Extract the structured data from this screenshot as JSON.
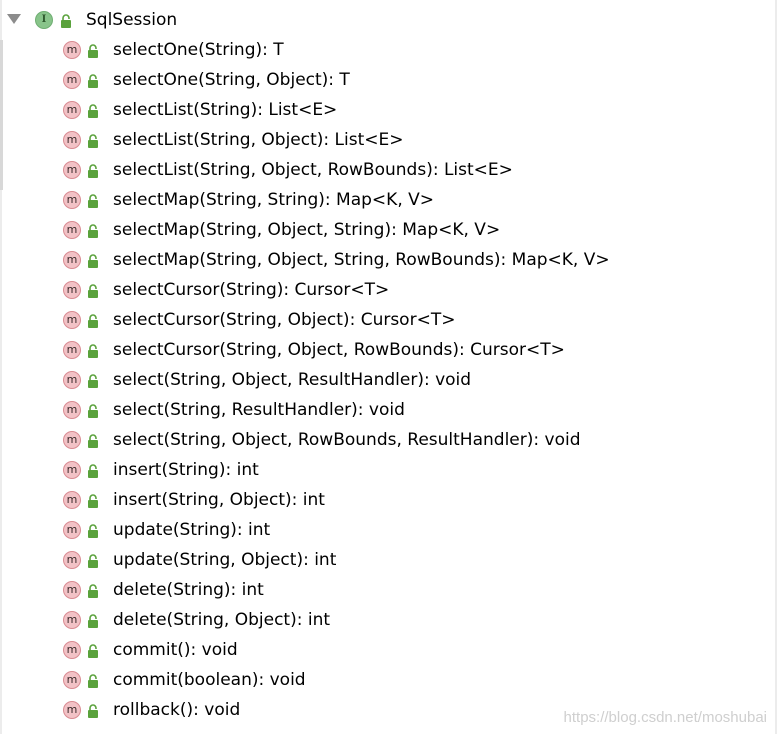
{
  "tree": {
    "root": {
      "icon": "interface-icon",
      "badge_letter": "I",
      "visibility_icon": "public-lock-icon",
      "label": "SqlSession"
    },
    "method_badge_letter": "m",
    "methods": [
      "selectOne(String): T",
      "selectOne(String, Object): T",
      "selectList(String): List<E>",
      "selectList(String, Object): List<E>",
      "selectList(String, Object, RowBounds): List<E>",
      "selectMap(String, String): Map<K, V>",
      "selectMap(String, Object, String): Map<K, V>",
      "selectMap(String, Object, String, RowBounds): Map<K, V>",
      "selectCursor(String): Cursor<T>",
      "selectCursor(String, Object): Cursor<T>",
      "selectCursor(String, Object, RowBounds): Cursor<T>",
      "select(String, Object, ResultHandler): void",
      "select(String, ResultHandler): void",
      "select(String, Object, RowBounds, ResultHandler): void",
      "insert(String): int",
      "insert(String, Object): int",
      "update(String): int",
      "update(String, Object): int",
      "delete(String): int",
      "delete(String, Object): int",
      "commit(): void",
      "commit(boolean): void",
      "rollback(): void"
    ]
  },
  "watermark": "https://blog.csdn.net/moshubai",
  "colors": {
    "interface_badge": "#88c48a",
    "method_badge": "#f2c2c6",
    "lock_green": "#5aa23c",
    "toggle": "#8c8c8c"
  }
}
